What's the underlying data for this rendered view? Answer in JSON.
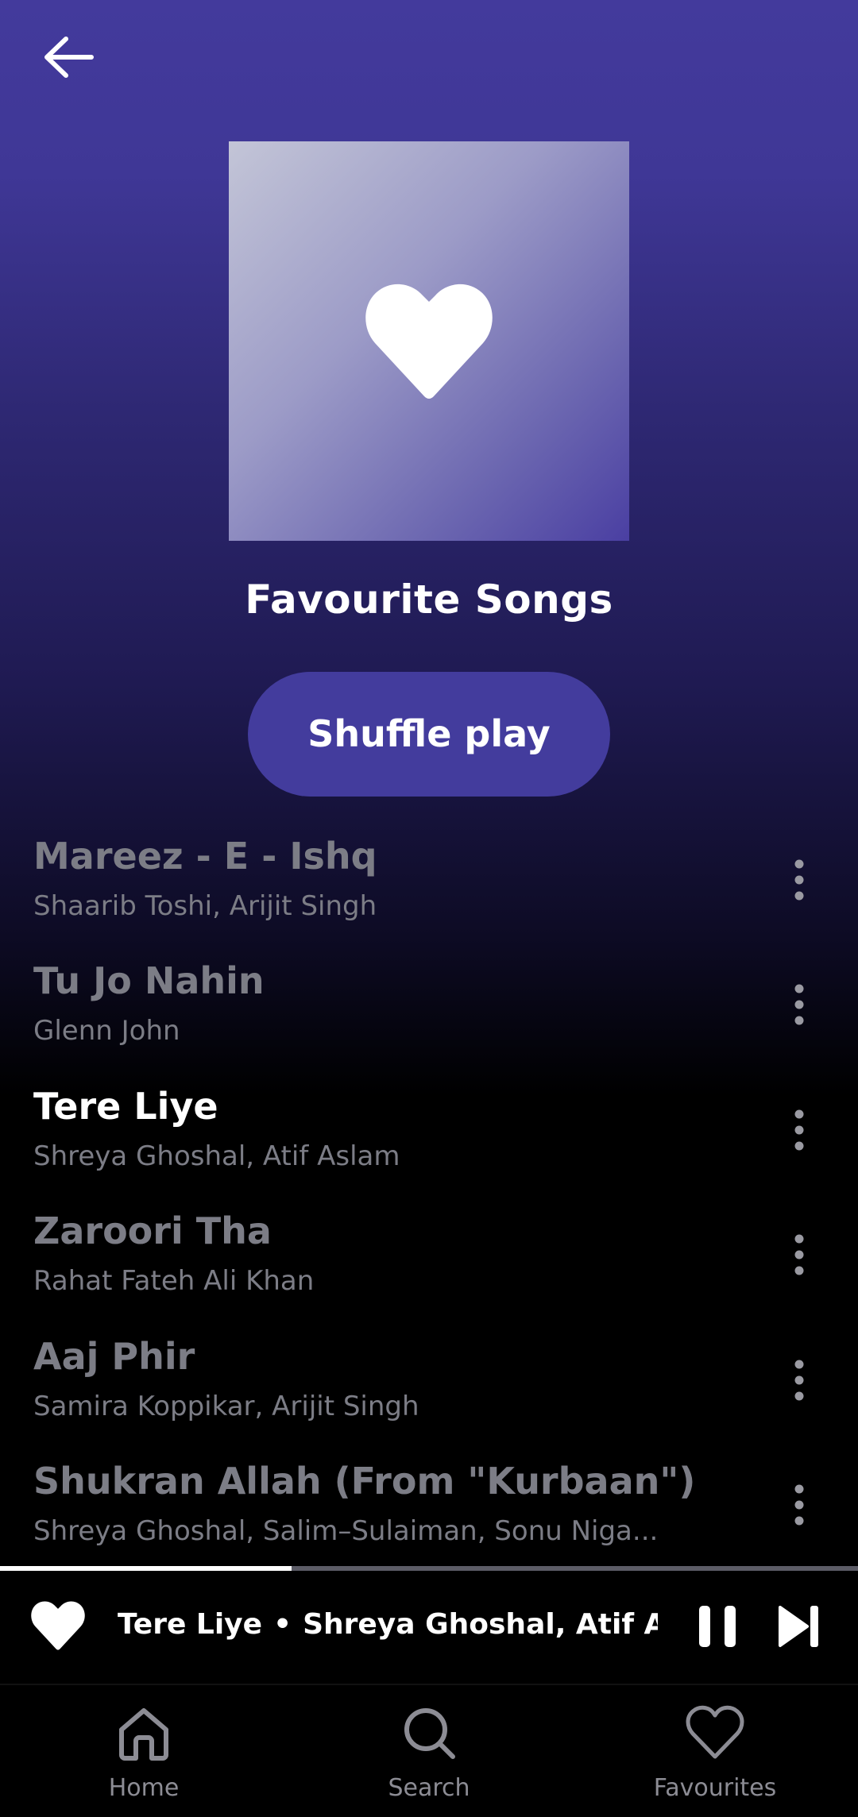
{
  "header": {
    "back_icon": "arrow-left-icon"
  },
  "playlist": {
    "cover_icon": "heart-icon",
    "title": "Favourite Songs",
    "shuffle_label": "Shuffle play"
  },
  "songs": [
    {
      "title": "Mareez - E - Ishq",
      "artist": "Shaarib Toshi, Arijit Singh",
      "playing": false
    },
    {
      "title": "Tu Jo Nahin",
      "artist": "Glenn John",
      "playing": false
    },
    {
      "title": "Tere Liye",
      "artist": "Shreya Ghoshal, Atif Aslam",
      "playing": true
    },
    {
      "title": "Zaroori Tha",
      "artist": "Rahat Fateh Ali Khan",
      "playing": false
    },
    {
      "title": "Aaj Phir",
      "artist": "Samira Koppikar, Arijit Singh",
      "playing": false
    },
    {
      "title": "Shukran Allah (From \"Kurbaan\")",
      "artist": "Shreya Ghoshal, Salim–Sulaiman, Sonu Niga...",
      "playing": false
    }
  ],
  "now_playing": {
    "title": "Tere Liye",
    "separator": "•",
    "artist": "Shreya Ghoshal, Atif As...",
    "progress": 0.34,
    "liked": true
  },
  "nav": {
    "items": [
      {
        "label": "Home",
        "icon": "home-icon"
      },
      {
        "label": "Search",
        "icon": "search-icon"
      },
      {
        "label": "Favourites",
        "icon": "heart-outline-icon"
      }
    ]
  },
  "colors": {
    "accent": "#433c9d",
    "muted_text": "#7c7d86",
    "nav_text": "#8c8c94"
  }
}
